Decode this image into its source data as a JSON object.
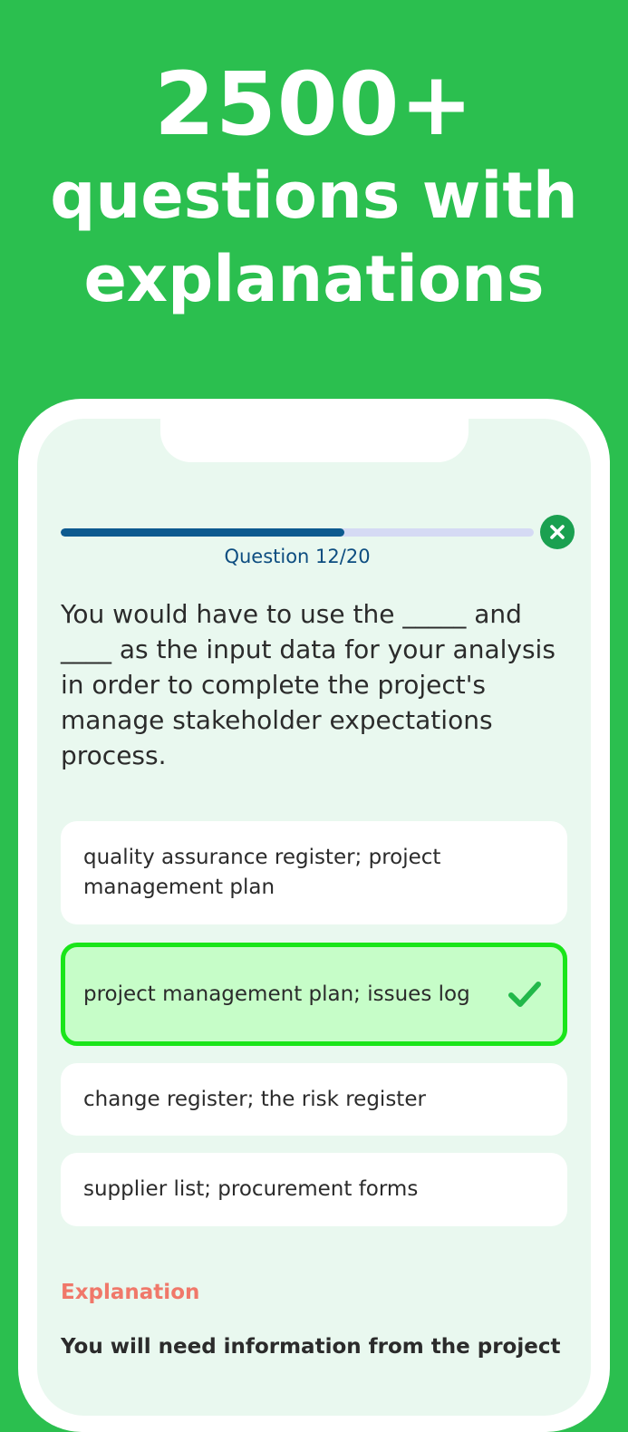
{
  "hero": {
    "line1": "2500+",
    "line2": "questions with",
    "line3": "explanations"
  },
  "quiz": {
    "progress": 0.6,
    "counter": "Question 12/20",
    "question": "You would have to use the _____ and ____ as the input data for your analysis in order to complete the project's manage stakeholder expectations process.",
    "options": [
      {
        "label": "quality assurance register; project management plan",
        "state": "default"
      },
      {
        "label": "project management plan; issues log",
        "state": "correct"
      },
      {
        "label": "change register; the risk register",
        "state": "default"
      },
      {
        "label": "supplier list; procurement forms",
        "state": "default"
      }
    ],
    "explanation_title": "Explanation",
    "explanation_text": "You will need information from the project"
  },
  "icons": {
    "close": "close-circle-icon",
    "check": "checkmark-icon"
  },
  "colors": {
    "background": "#2bbf4f",
    "progress_fill": "#0d5a8f",
    "selected_border": "#1ae51a",
    "selected_bg": "#c6fdc8",
    "explanation_title": "#f0786a"
  }
}
